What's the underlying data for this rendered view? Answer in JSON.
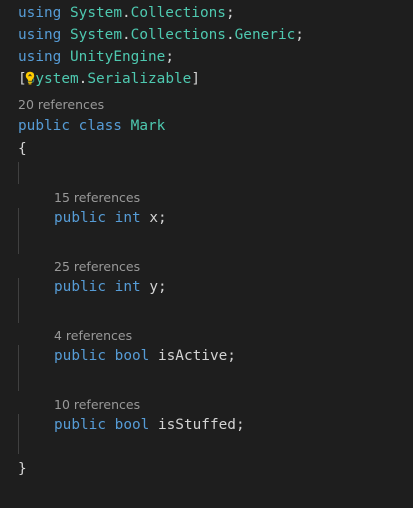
{
  "colors": {
    "background": "#1e1e1e",
    "keyword": "#569cd6",
    "type": "#4ec9b0",
    "text": "#d4d4d4",
    "codelens": "#999999",
    "indent_guide": "#404040",
    "lightbulb": "#ffcc00"
  },
  "icons": {
    "lightbulb": "lightbulb-icon"
  },
  "code": {
    "line1": {
      "keyword": "using",
      "ns1": "System",
      "dot": ".",
      "ns2": "Collections",
      "semi": ";"
    },
    "line2": {
      "keyword": "using",
      "ns1": "System",
      "dot1": ".",
      "ns2": "Collections",
      "dot2": ".",
      "ns3": "Generic",
      "semi": ";"
    },
    "line3": {
      "keyword": "using",
      "ns1": "UnityEngine",
      "semi": ";"
    },
    "line4": {
      "open": "[",
      "first_char": "S",
      "rest1": "ystem",
      "dot": ".",
      "attr": "Serializable",
      "close": "]"
    },
    "class_lens": "20 references",
    "class_decl": {
      "modifier": "public",
      "keyword": "class",
      "name": "Mark"
    },
    "open_brace": "{",
    "close_brace": "}",
    "fields": [
      {
        "lens": "15 references",
        "modifier": "public",
        "type": "int",
        "name": "x",
        "semi": ";"
      },
      {
        "lens": "25 references",
        "modifier": "public",
        "type": "int",
        "name": "y",
        "semi": ";"
      },
      {
        "lens": "4 references",
        "modifier": "public",
        "type": "bool",
        "name": "isActive",
        "semi": ";"
      },
      {
        "lens": "10 references",
        "modifier": "public",
        "type": "bool",
        "name": "isStuffed",
        "semi": ";"
      }
    ]
  }
}
